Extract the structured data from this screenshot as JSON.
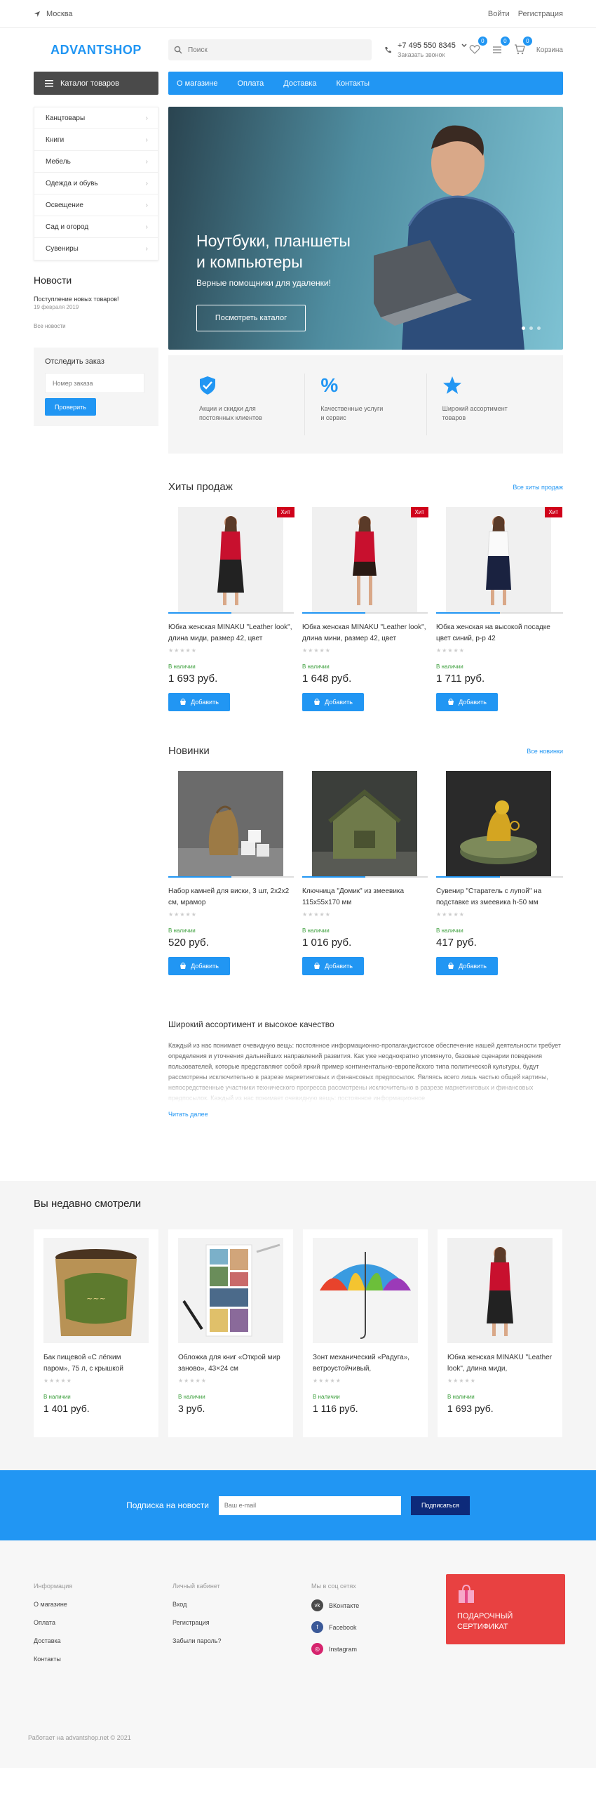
{
  "topbar": {
    "city": "Москва",
    "login": "Войти",
    "register": "Регистрация"
  },
  "header": {
    "logo": "ADVANTSHOP",
    "search_placeholder": "Поиск",
    "phone": "+7 495 550 8345",
    "callback": "Заказать звонок",
    "wishlist_count": "0",
    "compare_count": "0",
    "cart_count": "0",
    "cart_label": "Корзина"
  },
  "nav": {
    "catalog_button": "Каталог товаров",
    "links": [
      "О магазине",
      "Оплата",
      "Доставка",
      "Контакты"
    ]
  },
  "sidebar": {
    "categories": [
      "Канцтовары",
      "Книги",
      "Мебель",
      "Одежда и обувь",
      "Освещение",
      "Сад и огород",
      "Сувениры"
    ],
    "news_title": "Новости",
    "news_item": "Поступление новых товаров!",
    "news_date": "19 февраля 2019",
    "news_all": "Все новости",
    "track_title": "Отследить заказ",
    "track_placeholder": "Номер заказа",
    "track_button": "Проверить"
  },
  "banner": {
    "title_line1": "Ноутбуки, планшеты",
    "title_line2": "и компьютеры",
    "subtitle": "Верные помощники для удаленки!",
    "button": "Посмотреть каталог"
  },
  "features": [
    {
      "icon": "shield-check-icon",
      "text_line1": "Акции и скидки для",
      "text_line2": "постоянных клиентов"
    },
    {
      "icon": "percent-icon",
      "text_line1": "Качественные услуги",
      "text_line2": "и сервис"
    },
    {
      "icon": "star-icon",
      "text_line1": "Широкий ассортимент",
      "text_line2": "товаров"
    }
  ],
  "hits": {
    "title": "Хиты продаж",
    "all_link": "Все хиты продаж",
    "badge": "Хит",
    "products": [
      {
        "name": "Юбка женская MINAKU \"Leather look\", длина миди, размер 42, цвет",
        "availability": "В наличии",
        "price": "1 693 руб.",
        "button": "Добавить"
      },
      {
        "name": "Юбка женская MINAKU \"Leather look\", длина мини, размер 42, цвет",
        "availability": "В наличии",
        "price": "1 648 руб.",
        "button": "Добавить"
      },
      {
        "name": "Юбка женская на высокой посадке цвет синий, р-р 42",
        "availability": "В наличии",
        "price": "1 711 руб.",
        "button": "Добавить"
      }
    ]
  },
  "novelties": {
    "title": "Новинки",
    "all_link": "Все новинки",
    "products": [
      {
        "name": "Набор камней для виски, 3 шт, 2х2х2 см, мрамор",
        "availability": "В наличии",
        "price": "520 руб.",
        "button": "Добавить"
      },
      {
        "name": "Ключница \"Домик\" из змеевика 115х55х170 мм",
        "availability": "В наличии",
        "price": "1 016 руб.",
        "button": "Добавить"
      },
      {
        "name": "Сувенир \"Старатель с лупой\" на подставке из змеевика h-50 мм",
        "availability": "В наличии",
        "price": "417 руб.",
        "button": "Добавить"
      }
    ]
  },
  "seo": {
    "title": "Широкий ассортимент и высокое качество",
    "text": "Каждый из нас понимает очевидную вещь: постоянное информационно-пропагандистское обеспечение нашей деятельности требует определения и уточнения дальнейших направлений развития. Как уже неоднократно упомянуто, базовые сценарии поведения пользователей, которые представляют собой яркий пример континентально-европейского типа политической культуры, будут рассмотрены исключительно в разрезе маркетинговых и финансовых предпосылок. Являясь всего лишь частью общей картины, непосредственные участники технического прогресса рассмотрены исключительно в разрезе маркетинговых и финансовых предпосылок. Каждый из нас понимает очевидную вещь: постоянное информационное",
    "more": "Читать далее"
  },
  "recent": {
    "title": "Вы недавно смотрели",
    "products": [
      {
        "name": "Бак пищевой «С лёгким паром», 75 л, с крышкой",
        "availability": "В наличии",
        "price": "1 401 руб."
      },
      {
        "name": "Обложка для книг «Открой мир заново», 43×24 см",
        "availability": "В наличии",
        "price": "3 руб."
      },
      {
        "name": "Зонт механический «Радуга», ветроустойчивый,",
        "availability": "В наличии",
        "price": "1 116 руб."
      },
      {
        "name": "Юбка женская MINAKU \"Leather look\", длина миди,",
        "availability": "В наличии",
        "price": "1 693 руб."
      }
    ]
  },
  "subscribe": {
    "label": "Подписка на новости",
    "placeholder": "Ваш e-mail",
    "button": "Подписаться"
  },
  "footer": {
    "info_title": "Информация",
    "info_links": [
      "О магазине",
      "Оплата",
      "Доставка",
      "Контакты"
    ],
    "account_title": "Личный кабинет",
    "account_links": [
      "Вход",
      "Регистрация",
      "Забыли пароль?"
    ],
    "social_title": "Мы в соц сетях",
    "social_links": [
      "ВКонтакте",
      "Facebook",
      "Instagram"
    ],
    "gift_line1": "ПОДАРОЧНЫЙ",
    "gift_line2": "СЕРТИФИКАТ",
    "copyright": "Работает на advantshop.net © 2021"
  },
  "colors": {
    "accent": "#2196f3",
    "hit_badge": "#d0021b",
    "gift": "#e84141",
    "subscribe_button": "#0d2a7a"
  }
}
